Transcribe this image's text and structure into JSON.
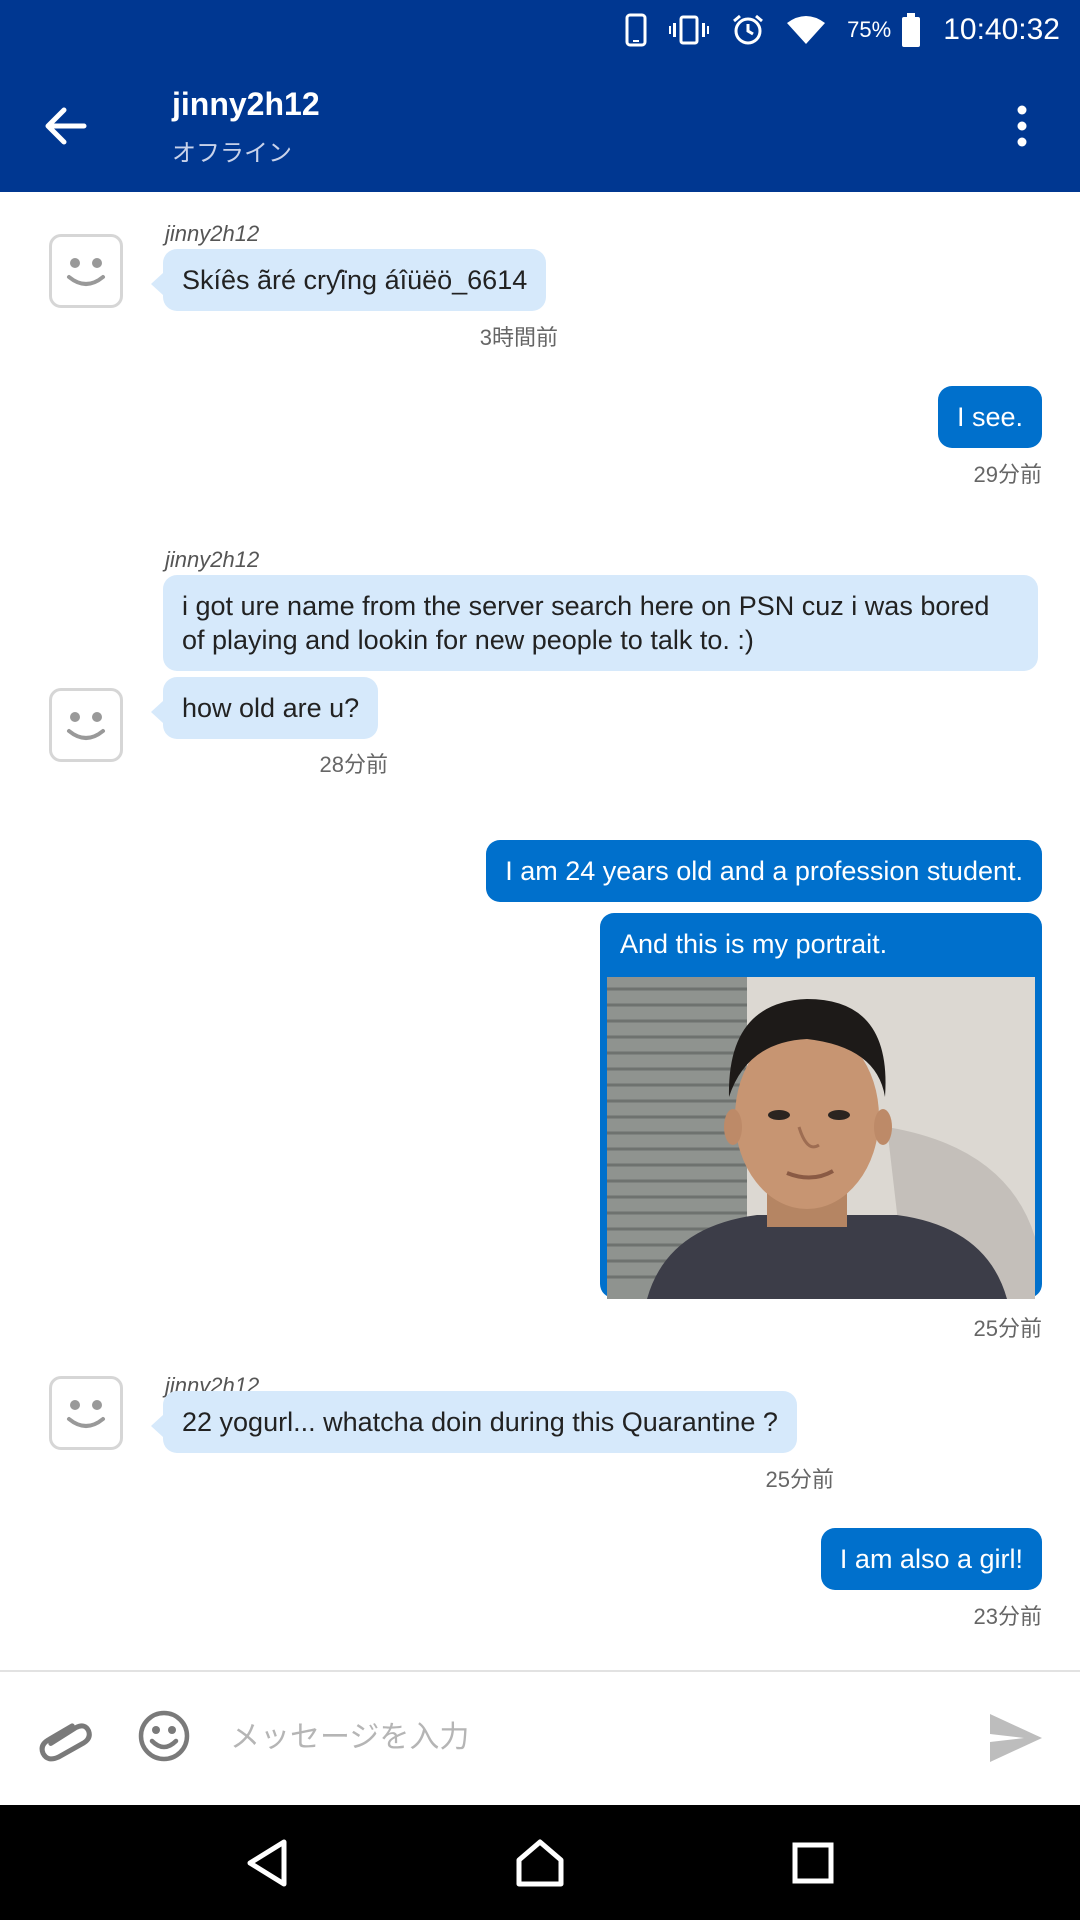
{
  "status_bar": {
    "battery_pct": "75%",
    "time": "10:40:32",
    "icons": [
      "phone-icon",
      "vibrate-icon",
      "alarm-icon",
      "wifi-icon",
      "battery-icon"
    ]
  },
  "header": {
    "title": "jinny2h12",
    "subtitle": "オフライン"
  },
  "messages": {
    "m1": {
      "sender": "jinny2h12",
      "text": "Skíês ãré crƴïng áîüëö_6614",
      "time": "3時間前"
    },
    "m2": {
      "text": "I see.",
      "time": "29分前"
    },
    "m3": {
      "sender": "jinny2h12",
      "text1": "i got ure name from the server search here on PSN cuz i was bored of playing and lookin for new people to talk to. :)",
      "text2": "how old are u?",
      "time": "28分前"
    },
    "m4": {
      "text1": "I am 24 years old and a profession student.",
      "caption": "And this is my portrait.",
      "time": "25分前"
    },
    "m5": {
      "sender": "jinny2h12",
      "text": "22 yogurl... whatcha doin during this Quarantine ?",
      "time": "25分前"
    },
    "m6": {
      "text": "I am also a girl!",
      "time": "23分前"
    }
  },
  "composer": {
    "placeholder": "メッセージを入力",
    "value": ""
  },
  "colors": {
    "header_bg": "#003791",
    "outgoing_bubble": "#0070cc",
    "incoming_bubble": "#d6e9fb"
  }
}
